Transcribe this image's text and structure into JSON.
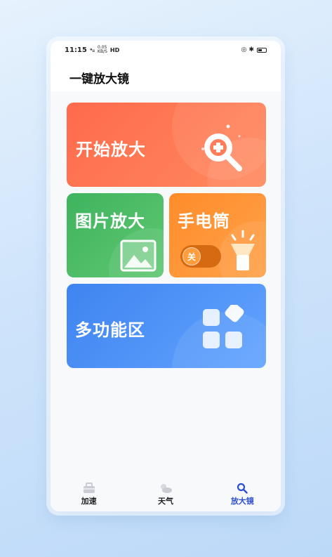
{
  "status_bar": {
    "time": "11:15",
    "signal": "ᵃᵢᵢ",
    "speed_top": "0.05",
    "speed_unit": "KB/S",
    "hd": "HD",
    "right_icons": "◎ ✱"
  },
  "header": {
    "title": "一键放大镜"
  },
  "cards": {
    "zoom": {
      "label": "开始放大"
    },
    "picture": {
      "label": "图片放大"
    },
    "torch": {
      "label": "手电筒",
      "toggle_label": "关"
    },
    "multi": {
      "label": "多功能区"
    }
  },
  "tabbar": {
    "items": [
      {
        "label": "加速",
        "icon": "accelerate-icon"
      },
      {
        "label": "天气",
        "icon": "weather-icon"
      },
      {
        "label": "放大镜",
        "icon": "magnifier-icon"
      }
    ],
    "active_index": 2,
    "active_color": "#2d4fd1"
  },
  "colors": {
    "zoom_card": "#ff6a4c",
    "picture_card": "#3fb35e",
    "torch_card": "#ff8c2a",
    "multi_card": "#3f84f0"
  }
}
